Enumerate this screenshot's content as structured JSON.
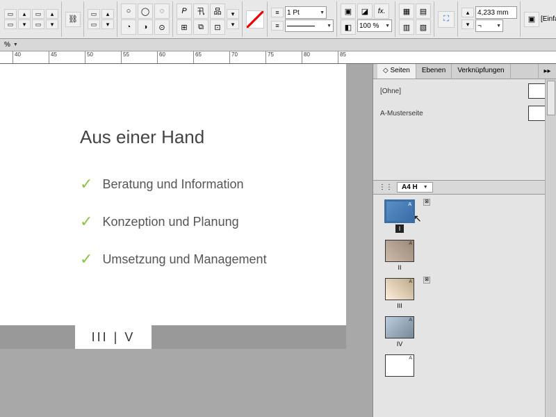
{
  "toolbar": {
    "stroke_weight": "1 Pt",
    "zoom": "100 %",
    "measure_value": "4,233 mm",
    "style_label": "[Einfacher"
  },
  "zoom_indicator": "%",
  "ruler": {
    "ticks": [
      "40",
      "45",
      "50",
      "55",
      "60",
      "65",
      "70",
      "75",
      "80",
      "85"
    ]
  },
  "document": {
    "heading": "Aus einer Hand",
    "bullets": [
      "Beratung und Information",
      "Konzeption und Planung",
      "Umsetzung und Management"
    ],
    "page_indicator": "III | V"
  },
  "panel": {
    "tabs": [
      "Seiten",
      "Ebenen",
      "Verknüpfungen"
    ],
    "active_tab": 0,
    "masters": [
      {
        "label": "[Ohne]"
      },
      {
        "label": "A-Musterseite"
      }
    ],
    "page_size": "A4 H",
    "thumbs": [
      {
        "label": "I",
        "selected": true,
        "has_close": true
      },
      {
        "label": "II",
        "selected": false,
        "has_close": false
      },
      {
        "label": "III",
        "selected": false,
        "has_close": true
      },
      {
        "label": "IV",
        "selected": false,
        "has_close": false
      },
      {
        "label": "",
        "selected": false,
        "has_close": false
      }
    ],
    "master_letter": "A"
  }
}
